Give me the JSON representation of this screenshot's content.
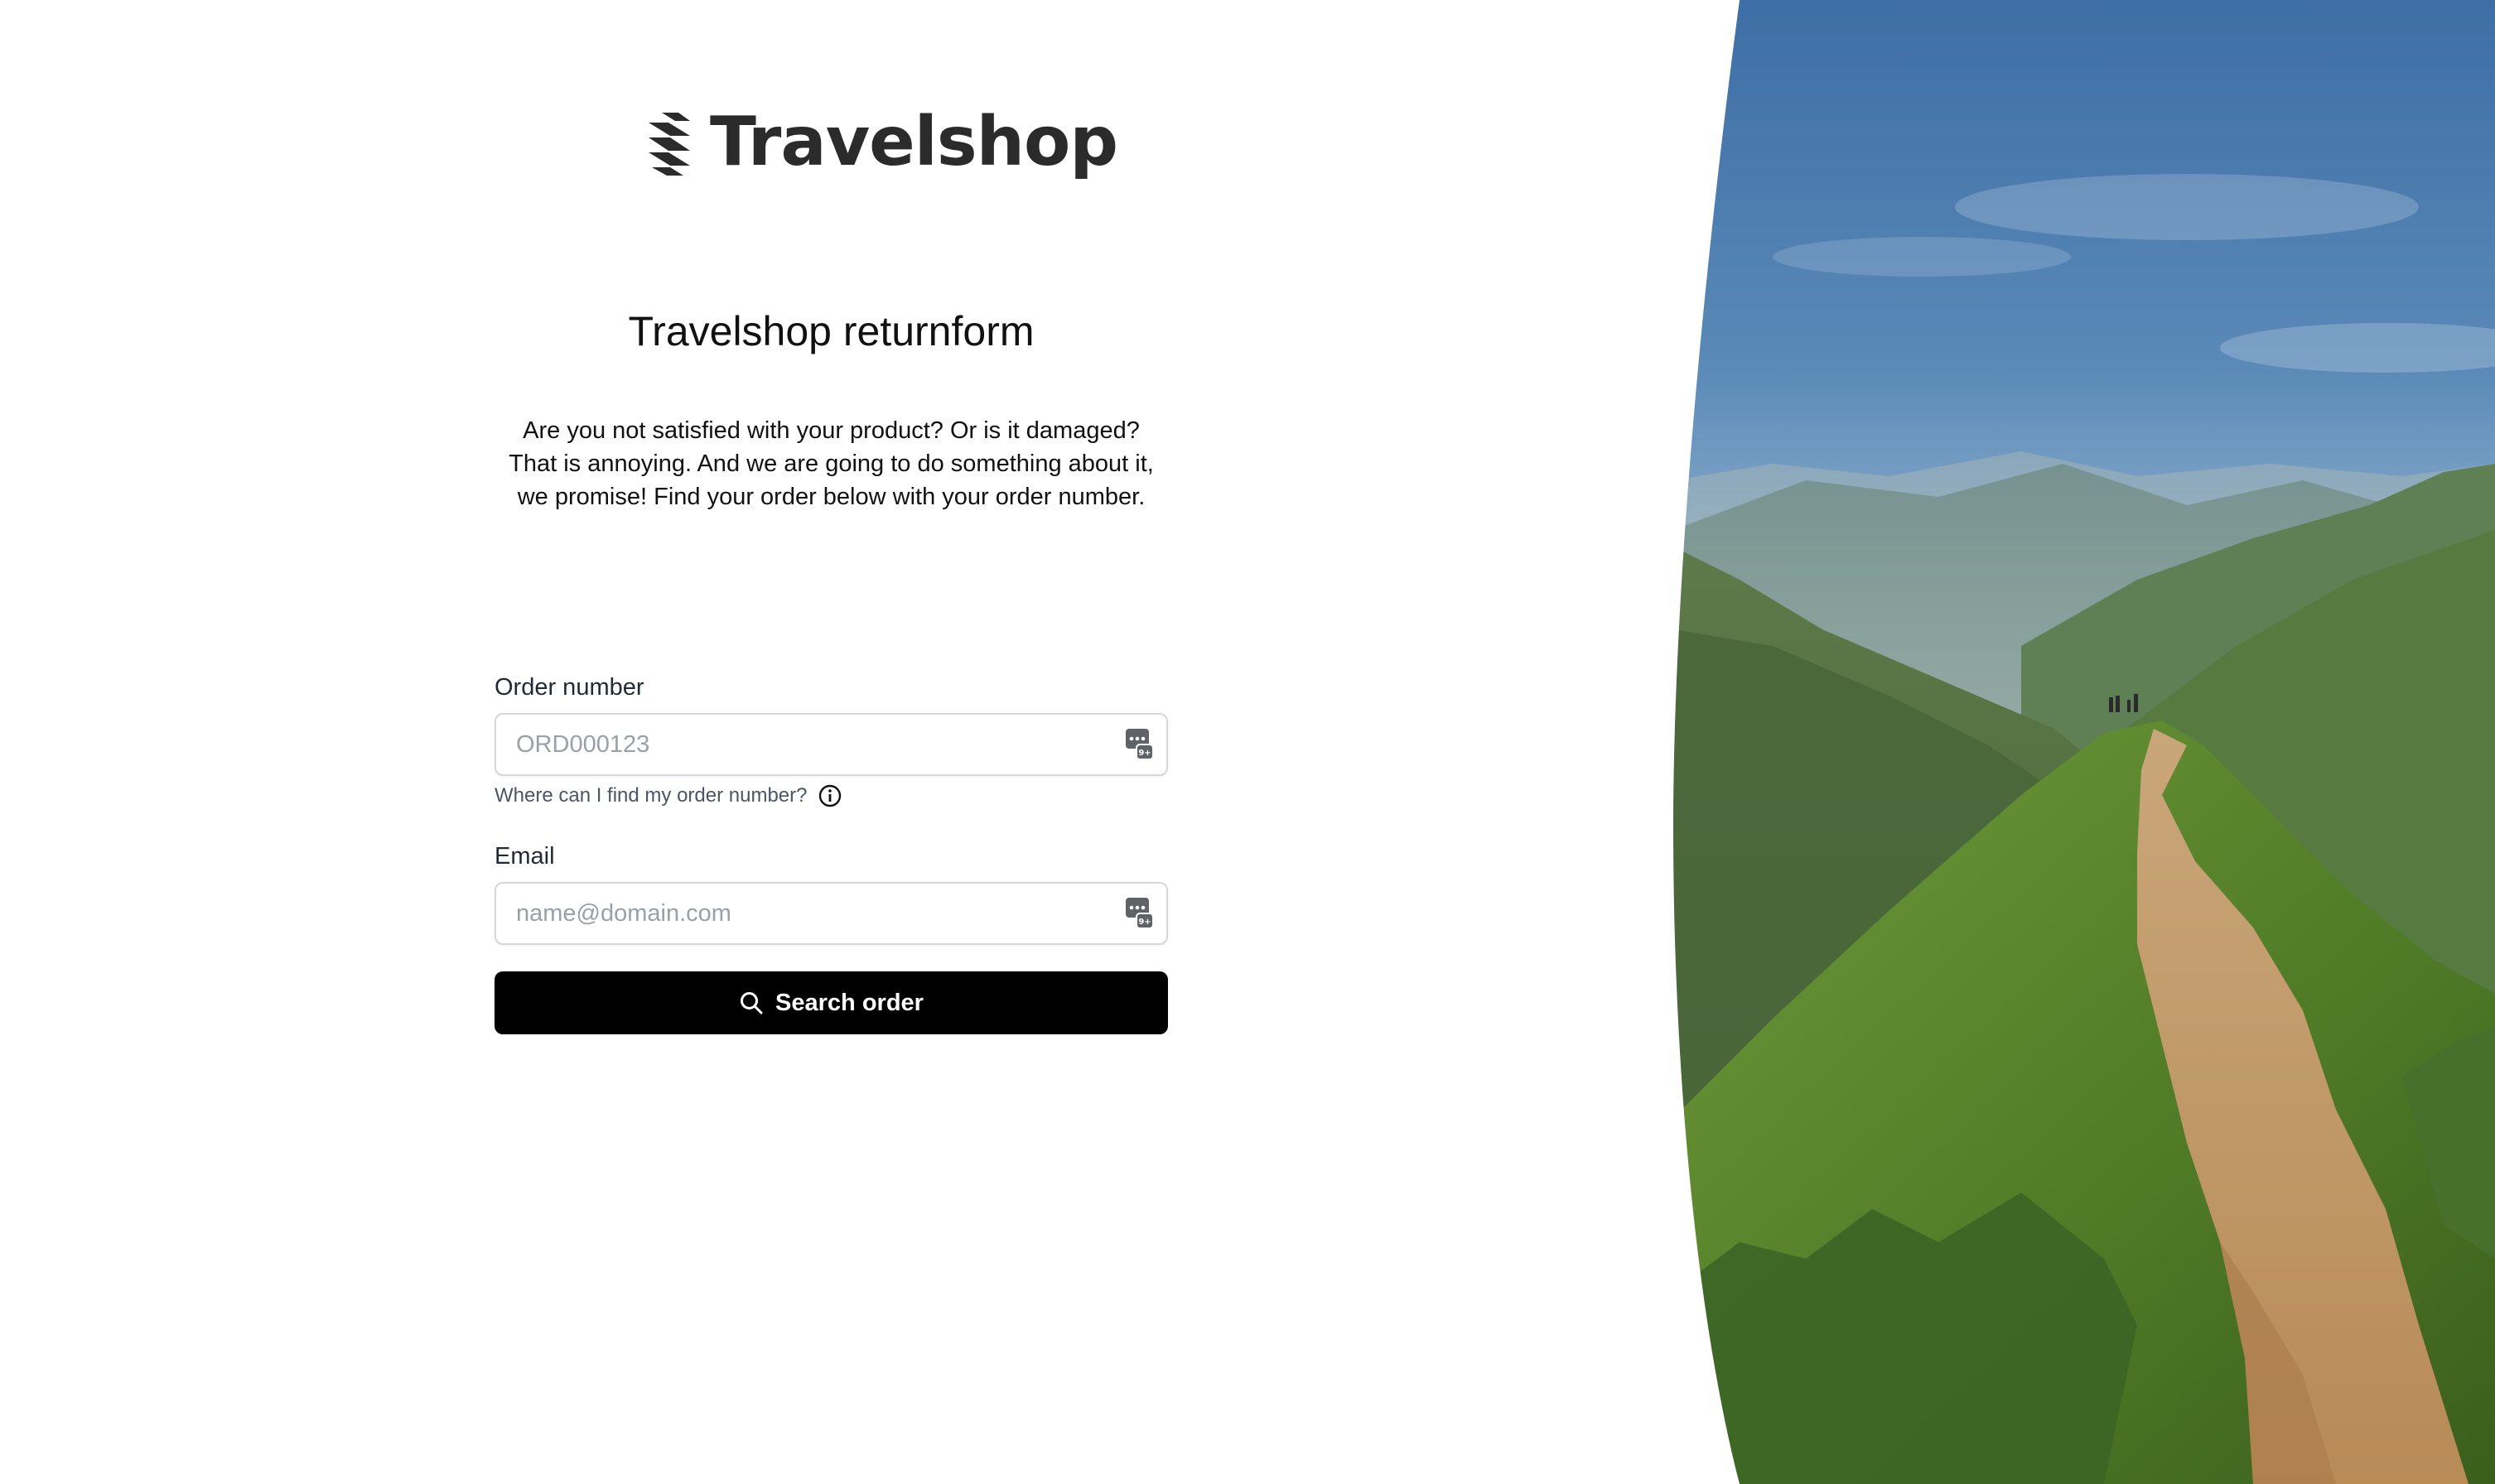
{
  "brand": {
    "name": "Travelshop"
  },
  "page": {
    "title": "Travelshop returnform",
    "intro_lines": [
      "Are you not satisfied with your product? Or is it damaged?",
      "That is annoying. And we are going to do something about it,",
      "we promise! Find your order below with your order number."
    ]
  },
  "form": {
    "order_number": {
      "label": "Order number",
      "placeholder": "ORD000123",
      "value": "",
      "help_text": "Where can I find my order number?",
      "help_icon": "info-icon"
    },
    "email": {
      "label": "Email",
      "placeholder": "name@domain.com",
      "value": ""
    },
    "autofill_icon": "autofill-card-icon",
    "submit": {
      "label": "Search order",
      "icon": "search-icon"
    }
  },
  "colors": {
    "button_bg": "#000000",
    "button_text": "#ffffff",
    "logo_text": "#2b2b2b",
    "input_border": "#d4d7dc",
    "placeholder": "#9aa0a6"
  },
  "hero_image": {
    "icon": "mountain-landscape-photo"
  }
}
